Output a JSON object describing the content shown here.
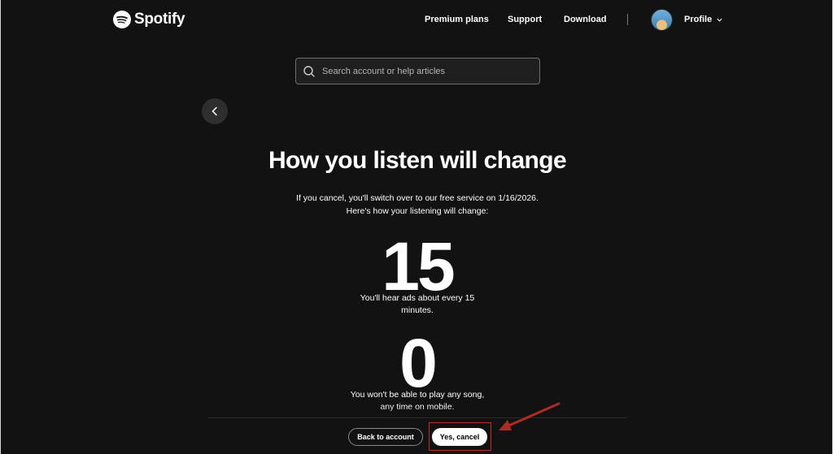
{
  "header": {
    "logo_text": "Spotify",
    "nav": [
      {
        "label": "Premium plans"
      },
      {
        "label": "Support"
      },
      {
        "label": "Download"
      }
    ],
    "profile_label": "Profile"
  },
  "search": {
    "placeholder": "Search account or help articles"
  },
  "content": {
    "title": "How you listen will change",
    "intro_line1": "If you cancel, you'll switch over to our free service on 1/16/2026.",
    "intro_line2": "Here's how your listening will change:",
    "stats": [
      {
        "number": "15",
        "desc_line1": "You'll hear ads about every 15",
        "desc_line2": "minutes."
      },
      {
        "number": "0",
        "desc_line1": "You won't be able to play any song,",
        "desc_line2": "any time on mobile."
      }
    ]
  },
  "footer": {
    "back_label": "Back to account",
    "confirm_label": "Yes, cancel"
  },
  "colors": {
    "background": "#121212",
    "annotation": "#c03028"
  }
}
